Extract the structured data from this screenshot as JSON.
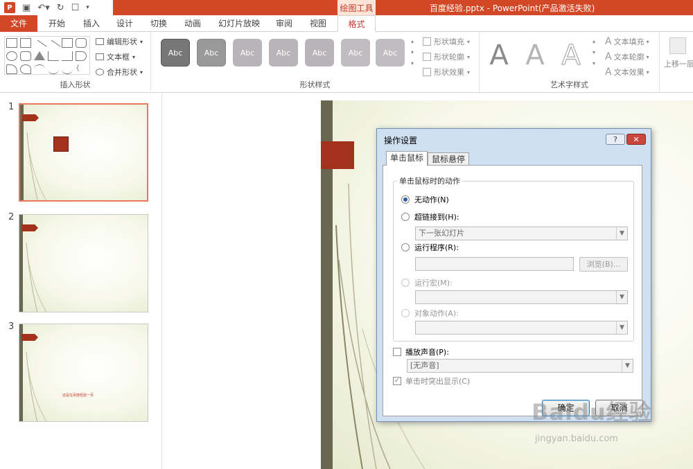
{
  "app": {
    "title": "百度经验.pptx - PowerPoint(产品激活失败)",
    "context_tool": "绘图工具",
    "logo_letter": "P",
    "qat": {
      "save_icon": "save-icon",
      "undo_icon": "undo-icon",
      "redo_icon": "redo-icon",
      "customize_icon": "customize-icon"
    }
  },
  "tabs": [
    {
      "label": "文件"
    },
    {
      "label": "开始"
    },
    {
      "label": "插入"
    },
    {
      "label": "设计"
    },
    {
      "label": "切换"
    },
    {
      "label": "动画"
    },
    {
      "label": "幻灯片放映"
    },
    {
      "label": "审阅"
    },
    {
      "label": "视图"
    },
    {
      "label": "格式"
    }
  ],
  "ribbon": {
    "insert_shapes": {
      "label": "插入形状",
      "edit_shape": "编辑形状",
      "text_box": "文本框",
      "merge_shapes": "合并形状"
    },
    "shape_styles": {
      "label": "形状样式",
      "sample_text": "Abc",
      "fill": "形状填充",
      "outline": "形状轮廓",
      "effects": "形状效果"
    },
    "wordart_styles": {
      "label": "艺术字样式",
      "sample": "A",
      "text_fill": "文本填充",
      "text_outline": "文本轮廓",
      "text_effects": "文本效果"
    },
    "arrange": {
      "bring_forward": "上移一层"
    }
  },
  "thumbnails": [
    {
      "num": "1"
    },
    {
      "num": "2"
    },
    {
      "num": "3",
      "text": "这是在百度经验一页"
    }
  ],
  "dialog": {
    "title": "操作设置",
    "help": "?",
    "close": "✕",
    "tabs": [
      "单击鼠标",
      "鼠标悬停"
    ],
    "group_label": "单击鼠标时的动作",
    "options": {
      "none": "无动作(N)",
      "hyperlink": "超链接到(H):",
      "hyperlink_value": "下一张幻灯片",
      "run_program": "运行程序(R):",
      "browse": "浏览(B)...",
      "run_macro": "运行宏(M):",
      "object_action": "对象动作(A):"
    },
    "play_sound": "播放声音(P):",
    "sound_value": "[无声音]",
    "highlight_click": "单击时突出显示(C)",
    "ok": "确定",
    "cancel": "取消"
  },
  "watermark": {
    "logo": "Baidu经验",
    "url": "jingyan.baidu.com"
  },
  "colors": {
    "accent": "#d24726",
    "slide_bar": "#6b6650",
    "slide_flag": "#a3321c",
    "dialog_frame": "#cfe0f3"
  }
}
